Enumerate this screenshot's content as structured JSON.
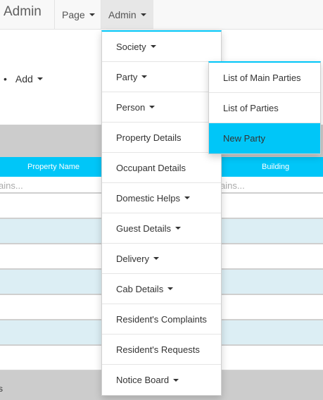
{
  "navbar": {
    "brand": "Admin",
    "page_label": "Page",
    "admin_label": "Admin"
  },
  "subnav": {
    "add_label": "Add"
  },
  "grid": {
    "columns": [
      "Property Name",
      "Building"
    ],
    "filter_placeholder_left": "ains...",
    "filter_placeholder_right": "ains...",
    "footer_text": "s"
  },
  "admin_menu": [
    {
      "label": "Society",
      "has_submenu": true
    },
    {
      "label": "Party",
      "has_submenu": true
    },
    {
      "label": "Person",
      "has_submenu": true
    },
    {
      "label": "Property Details",
      "has_submenu": false
    },
    {
      "label": "Occupant Details",
      "has_submenu": false
    },
    {
      "label": "Domestic Helps",
      "has_submenu": true
    },
    {
      "label": "Guest Details",
      "has_submenu": true
    },
    {
      "label": "Delivery",
      "has_submenu": true
    },
    {
      "label": "Cab Details",
      "has_submenu": true
    },
    {
      "label": "Resident's Complaints",
      "has_submenu": false
    },
    {
      "label": "Resident's Requests",
      "has_submenu": false
    },
    {
      "label": "Notice Board",
      "has_submenu": true
    }
  ],
  "party_submenu": [
    {
      "label": "List of Main Parties"
    },
    {
      "label": "List of Parties"
    },
    {
      "label": "New Party",
      "active": true
    }
  ],
  "colors": {
    "accent": "#00c6f8",
    "row_alt": "#dceef4",
    "toolbar": "#cccccc"
  }
}
